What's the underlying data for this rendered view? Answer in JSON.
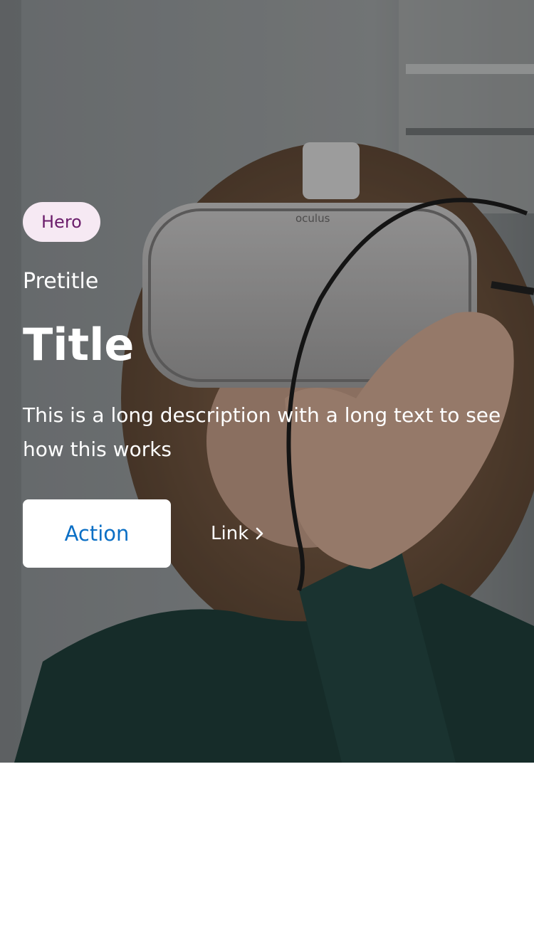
{
  "hero": {
    "badge": "Hero",
    "pretitle": "Pretitle",
    "title": "Title",
    "description": "This is a long description with a long text to see how this works",
    "primary_action": "Action",
    "link": "Link",
    "link_icon": "chevron-right-icon",
    "image_brand_mark": "oculus"
  },
  "colors": {
    "badge_bg": "#f6e9f3",
    "badge_text": "#6b1d6b",
    "action_text": "#0b6fc5"
  }
}
